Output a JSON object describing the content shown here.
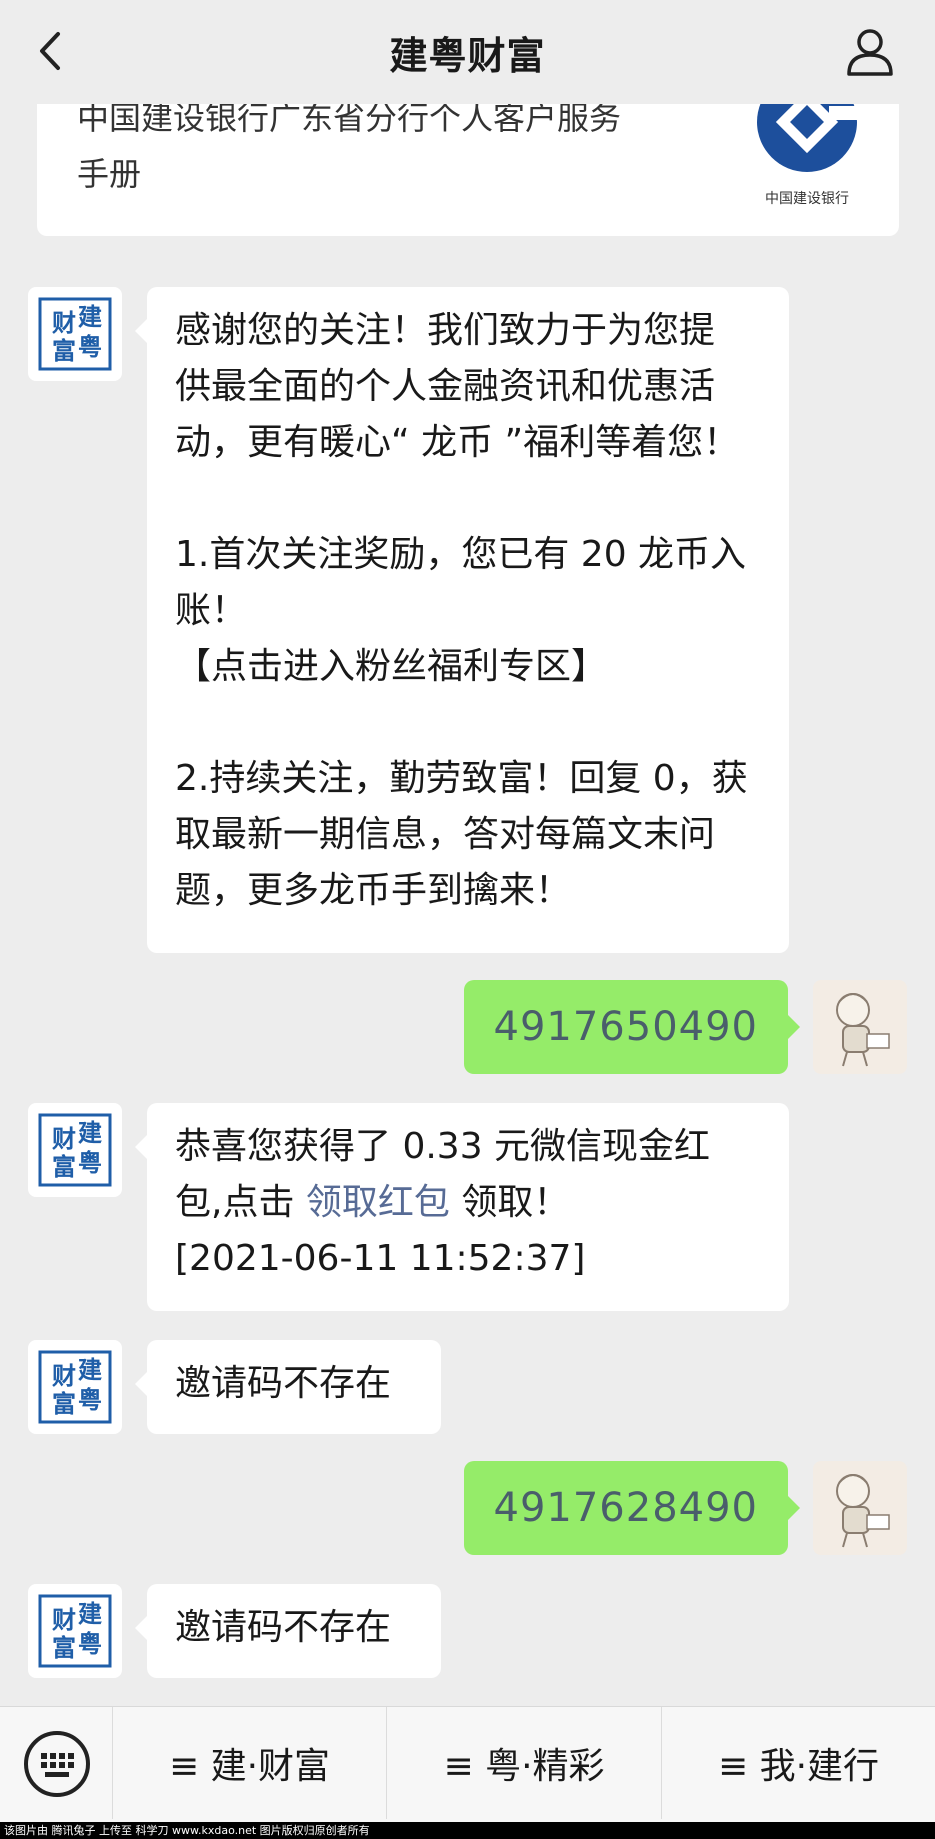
{
  "header": {
    "title": "建粤财富",
    "back_icon": "chevron-left-icon",
    "user_icon": "user-icon"
  },
  "card": {
    "line1": "中国建设银行广东省分行个人客户服务",
    "line2": "手册",
    "logo_caption": "中国建设银行",
    "logo_color": "#1d4f9c"
  },
  "avatar_account": {
    "glyphs": [
      "财",
      "建",
      "富",
      "粤"
    ],
    "color": "#1f5ea8"
  },
  "messages": {
    "welcome": {
      "lines": [
        "感谢您的关注！我们致力于为您提",
        "供最全面的个人金融资讯和优惠活",
        "动，更有暖心“ 龙币 ”福利等着您！",
        "",
        "1.首次关注奖励，您已有 20 龙币入",
        "账！",
        "【点击进入粉丝福利专区】",
        "",
        "2.持续关注，勤劳致富！回复 0，获",
        "取最新一期信息，答对每篇文末问",
        "题，更多龙币手到擒来！"
      ]
    },
    "sent1": "4917650490",
    "redpacket": {
      "line1": "恭喜您获得了 0.33 元微信现金红",
      "line2_prefix": "包,点击 ",
      "line2_link": "领取红包",
      "line2_suffix": " 领取！",
      "line3": "[2021-06-11 11:52:37]"
    },
    "reply1": "邀请码不存在",
    "sent2": "4917628490",
    "reply2": "邀请码不存在"
  },
  "bottom_bar": {
    "keyboard_icon": "keyboard-icon",
    "menus": [
      "≡ 建·财富",
      "≡ 粤·精彩",
      "≡ 我·建行"
    ]
  },
  "footer_note": "该图片由 腾讯兔子 上传至 科学刀 www.kxdao.net 图片版权归原创者所有",
  "colors": {
    "background": "#ededed",
    "sent_bubble": "#95ec69",
    "link": "#576b95"
  }
}
